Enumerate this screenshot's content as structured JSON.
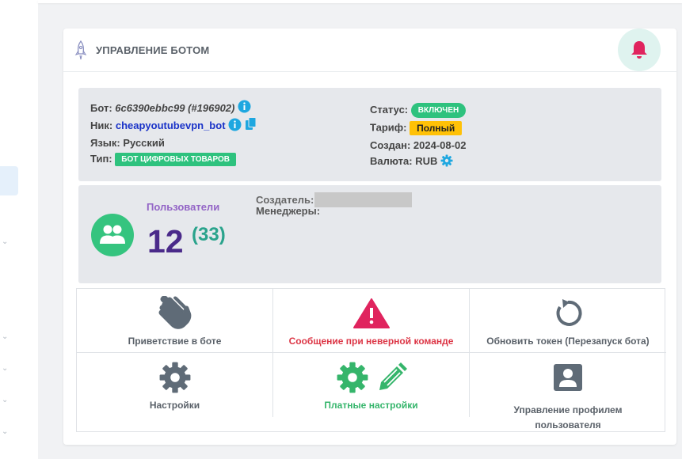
{
  "header": {
    "title": "УПРАВЛЕНИЕ БОТОМ"
  },
  "bot": {
    "bot_label": "Бот:",
    "bot_id": "6c6390ebbc99 (#196902)",
    "nick_label": "Ник:",
    "nick": "cheapyoutubevpn_bot",
    "lang_label": "Язык:",
    "lang": "Русский",
    "type_label": "Тип:",
    "type_badge": "БОТ ЦИФРОВЫХ ТОВАРОВ",
    "status_label": "Статус:",
    "status_badge": "ВКЛЮЧЕН",
    "tariff_label": "Тариф:",
    "tariff_badge": "Полный",
    "created_label": "Создан:",
    "created": "2024-08-02",
    "currency_label": "Валюта:",
    "currency": "RUB"
  },
  "stats": {
    "users_label": "Пользователи",
    "users_count": "12",
    "users_total": "(33)",
    "creator_label": "Создатель:",
    "managers_label": "Менеджеры:"
  },
  "actions": {
    "greeting": "Приветствие в боте",
    "bad_command": "Сообщение при неверной команде",
    "refresh_token": "Обновить токен (Перезапуск бота)",
    "settings": "Настройки",
    "paid_settings": "Платные настройки",
    "profile_line1": "Управление профилем",
    "profile_line2": "пользователя"
  },
  "colors": {
    "accent_green": "#2ec27e",
    "danger_red": "#dc3545",
    "purple": "#9364c6",
    "tariff_yellow": "#ffc107"
  },
  "icons": [
    "rocket-icon",
    "bell-icon",
    "info-icon",
    "copy-icon",
    "gear-icon",
    "users-icon",
    "wave-hand-icon",
    "warning-icon",
    "refresh-icon",
    "settings-gear-icon",
    "edit-icon",
    "profile-icon"
  ]
}
